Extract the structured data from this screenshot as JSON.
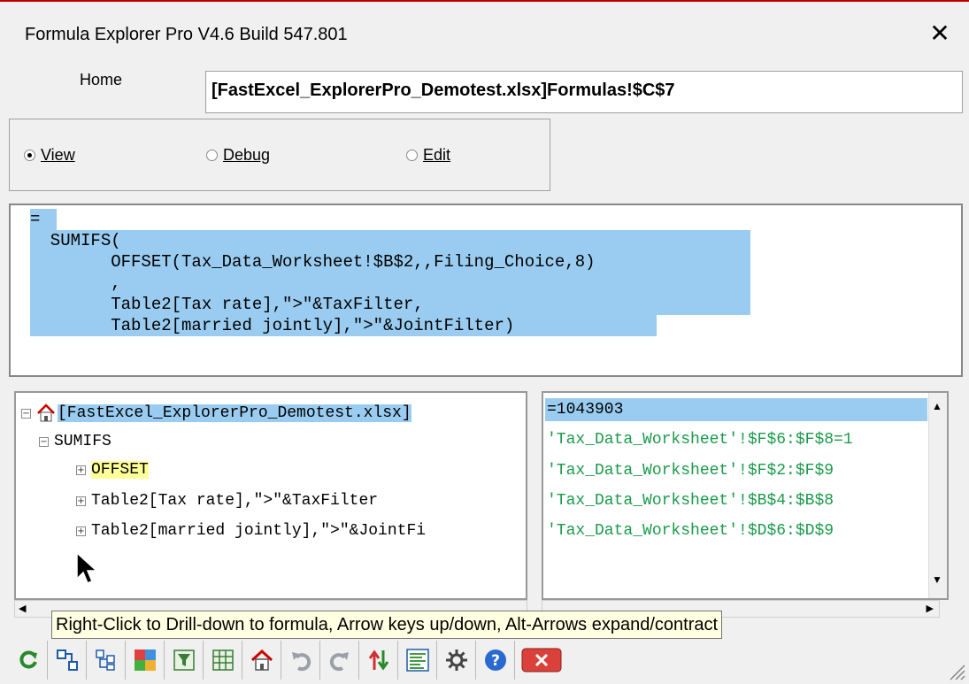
{
  "window": {
    "title": "Formula Explorer Pro V4.6 Build 547.801",
    "close_glyph": "✕"
  },
  "home": {
    "label": "Home",
    "address": "[FastExcel_ExplorerPro_Demotest.xlsx]Formulas!$C$7"
  },
  "modes": [
    {
      "label": "View",
      "selected": true
    },
    {
      "label": "Debug",
      "selected": false
    },
    {
      "label": "Edit",
      "selected": false
    }
  ],
  "formula_lines": [
    "=",
    "  SUMIFS(",
    "        OFFSET(Tax_Data_Worksheet!$B$2,,Filing_Choice,8)",
    "        ,",
    "        Table2[Tax rate],\">\"&TaxFilter,",
    "        Table2[married jointly],\">\"&JointFilter)"
  ],
  "tree": {
    "root": "[FastExcel_ExplorerPro_Demotest.xlsx]",
    "function": "SUMIFS",
    "children": [
      "OFFSET",
      "Table2[Tax rate],\">\"&TaxFilter",
      "Table2[married jointly],\">\"&JointFi"
    ]
  },
  "results": [
    "=1043903",
    "'Tax_Data_Worksheet'!$F$6:$F$8=1",
    "'Tax_Data_Worksheet'!$F$2:$F$9",
    "'Tax_Data_Worksheet'!$B$4:$B$8",
    "'Tax_Data_Worksheet'!$D$6:$D$9"
  ],
  "tooltip": "Right-Click to Drill-down to formula, Arrow keys up/down, Alt-Arrows expand/contract",
  "toolbar_icons": [
    "refresh-icon",
    "drilldown-icon",
    "expand-icon",
    "color-icon",
    "filter-icon",
    "grid-icon",
    "home-icon",
    "undo-icon",
    "redo-icon",
    "sort-icon",
    "list-icon",
    "settings-icon",
    "help-icon",
    "close-window-icon"
  ],
  "colors": {
    "selection_blue": "#99ccf0",
    "highlight_yellow": "#ffff99",
    "result_green": "#1a9a4a",
    "close_red": "#d9413a"
  }
}
